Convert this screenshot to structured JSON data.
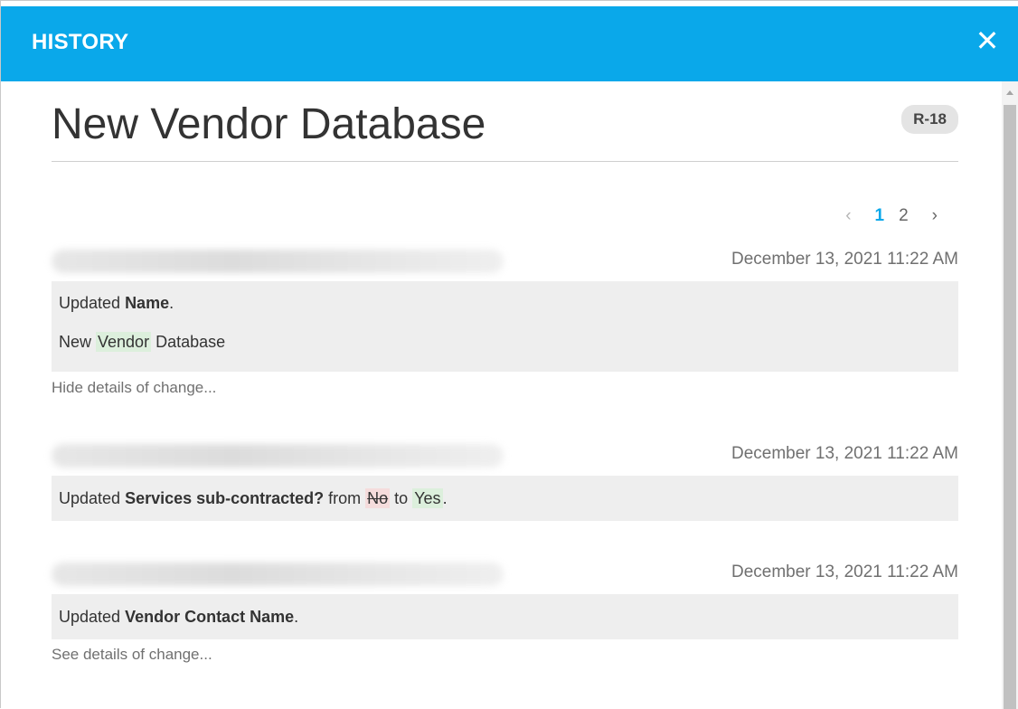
{
  "header": {
    "title": "HISTORY",
    "close_glyph": "✕",
    "accent_color": "#0aa8ea"
  },
  "record": {
    "title": "New Vendor Database",
    "badge": "R-18"
  },
  "pagination": {
    "prev": "‹",
    "pages": [
      "1",
      "2"
    ],
    "current": "1",
    "next": "›"
  },
  "entries": [
    {
      "user": "(blurred user name and email)",
      "timestamp": "December 13, 2021 11:22 AM",
      "summary_prefix": "Updated ",
      "field": "Name",
      "summary_suffix": ".",
      "detail_before": "New ",
      "detail_added": "Vendor",
      "detail_after": " Database",
      "details_link": "Hide details of change..."
    },
    {
      "user": "(blurred user name and email)",
      "timestamp": "December 13, 2021 11:22 AM",
      "summary_prefix": "Updated ",
      "field": "Services sub-contracted?",
      "from_word": " from ",
      "old_value": "No",
      "to_word": " to ",
      "new_value": "Yes",
      "summary_suffix": "."
    },
    {
      "user": "(blurred user name and email)",
      "timestamp": "December 13, 2021 11:22 AM",
      "summary_prefix": "Updated ",
      "field": "Vendor Contact Name",
      "summary_suffix": ".",
      "details_link": "See details of change..."
    }
  ]
}
